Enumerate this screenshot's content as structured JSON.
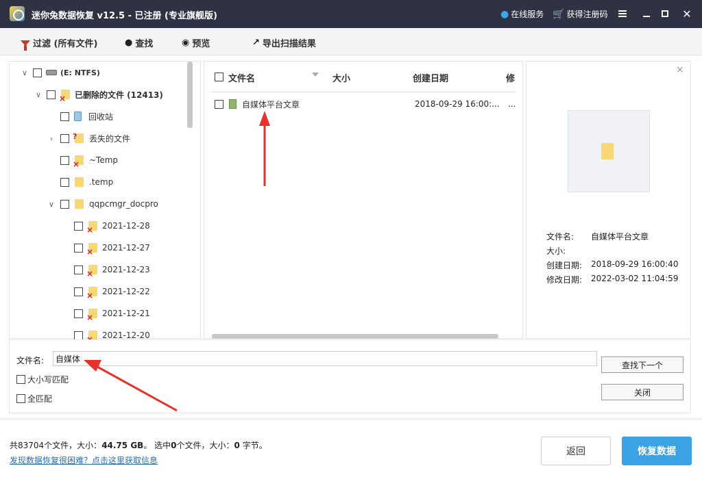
{
  "titlebar": {
    "title": "迷你兔数据恢复 v12.5 - 已注册 (专业旗舰版)",
    "online_service": "在线服务",
    "get_code": "获得注册码"
  },
  "toolbar": {
    "filter": "过滤 (所有文件)",
    "find": "查找",
    "preview": "预览",
    "export": "导出扫描结果"
  },
  "tree": {
    "drive": "(E: NTFS)",
    "deleted": "已删除的文件 (12413)",
    "recycle": "回收站",
    "lost": "丢失的文件",
    "temp1": "~Temp",
    "temp2": ".temp",
    "qqpc": "qqpcmgr_docpro",
    "d1": "2021-12-28",
    "d2": "2021-12-27",
    "d3": "2021-12-23",
    "d4": "2021-12-22",
    "d5": "2021-12-21",
    "d6": "2021-12-20"
  },
  "list": {
    "col_name": "文件名",
    "col_size": "大小",
    "col_created": "创建日期",
    "col_modified": "修",
    "row_name": "自媒体平台文章",
    "row_created": "2018-09-29 16:00:...",
    "row_more": "..."
  },
  "preview": {
    "label_name": "文件名:",
    "value_name": "自媒体平台文章",
    "label_size": "大小:",
    "value_size": "",
    "label_created": "创建日期:",
    "value_created": "2018-09-29 16:00:40",
    "label_modified": "修改日期:",
    "value_modified": "2022-03-02 11:04:59"
  },
  "search": {
    "label": "文件名:",
    "value": "自媒体",
    "case": "大小写匹配",
    "whole": "全匹配",
    "find_next": "查找下一个",
    "close": "关闭"
  },
  "bottom": {
    "summary_prefix": "共83704个文件，大小：",
    "summary_size": "44.75 GB",
    "summary_mid": "。 选中",
    "summary_count": "0",
    "summary_mid2": "个文件，大小：",
    "summary_bytes": "0",
    "summary_end": " 字节。",
    "help": "发现数据恢复很困难？点击这里获取信息",
    "back": "返回",
    "recover": "恢复数据"
  }
}
